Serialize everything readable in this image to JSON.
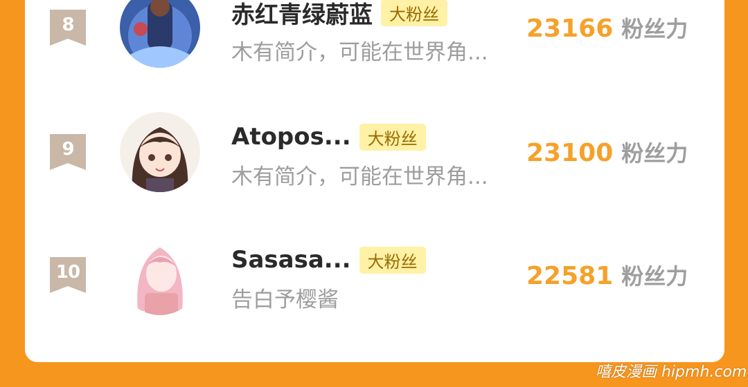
{
  "rank_badge_color": "#c9b7a8",
  "accent_color": "#f7961f",
  "score_color": "#f5a12a",
  "badge_bg": "#fff1a6",
  "entries": [
    {
      "rank": "8",
      "name": "赤红青绿蔚蓝",
      "badge": "大粉丝",
      "desc": "木有简介，可能在世界角...",
      "score": "23166",
      "unit": "粉丝力",
      "avatar_icon": "anime-character-avatar-blue"
    },
    {
      "rank": "9",
      "name": "Atopos...",
      "badge": "大粉丝",
      "desc": "木有简介，可能在世界角...",
      "score": "23100",
      "unit": "粉丝力",
      "avatar_icon": "anime-girl-brown-hair-avatar"
    },
    {
      "rank": "10",
      "name": "Sasasa...",
      "badge": "大粉丝",
      "desc": "告白予樱酱",
      "score": "22581",
      "unit": "粉丝力",
      "avatar_icon": "anime-girl-pink-hair-avatar"
    }
  ],
  "watermark": "嘻皮漫画 hipmh.com"
}
